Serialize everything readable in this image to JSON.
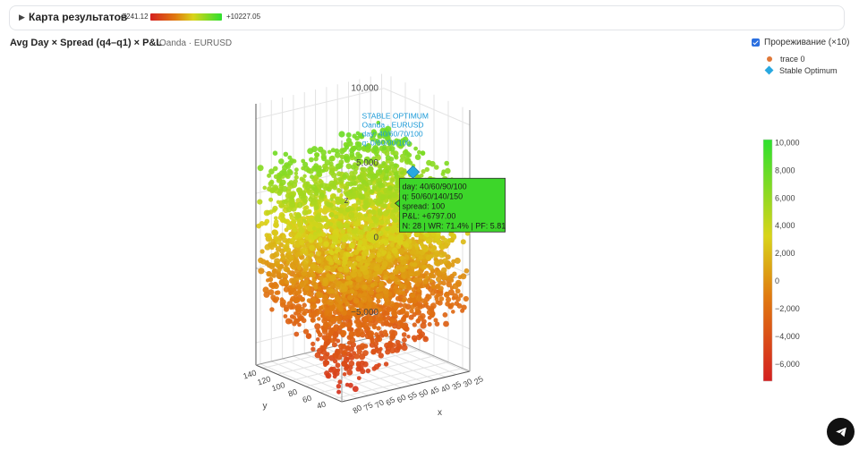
{
  "results_bar": {
    "title": "Карта результатов",
    "min_value": "-7241.12",
    "max_value": "+10227.05",
    "gradient_colors": [
      "#d42020",
      "#e07a10",
      "#d9d41a",
      "#2ee02e"
    ]
  },
  "heading": {
    "title": "Avg Day × Spread (q4–q1) × P&L",
    "subtitle": "Oanda · EURUSD"
  },
  "thinning": {
    "label": "Прореживание (×10)",
    "checked": true
  },
  "legend": {
    "items": [
      {
        "label": "trace 0",
        "color": "#e07838",
        "marker": "circle"
      },
      {
        "label": "Stable Optimum",
        "color": "#29a8e0",
        "marker": "diamond"
      }
    ]
  },
  "chart_data": {
    "type": "scatter3d",
    "axes": {
      "x": {
        "label": "x",
        "ticks": [
          25,
          30,
          35,
          40,
          45,
          50,
          55,
          60,
          65,
          70,
          75,
          80
        ]
      },
      "y": {
        "label": "y",
        "ticks": [
          40,
          60,
          80,
          100,
          120,
          140
        ]
      },
      "z": {
        "label": "z",
        "ticks": [
          -5000,
          0,
          5000,
          10000
        ],
        "tick_labels": [
          "−5,000",
          "0",
          "5,000",
          "10,000"
        ]
      }
    },
    "colorbar": {
      "min": -7241.12,
      "max": 10227.05,
      "ticks": [
        10000,
        8000,
        6000,
        4000,
        2000,
        0,
        -2000,
        -4000,
        -6000
      ],
      "tick_labels": [
        "10,000",
        "8,000",
        "6,000",
        "4,000",
        "2,000",
        "0",
        "−2,000",
        "−4,000",
        "−6,000"
      ]
    },
    "stable_optimum": {
      "x": 40,
      "y": 60,
      "z": 6797.0,
      "label_lines": [
        "STABLE OPTIMUM",
        "Oanda · EURUSD",
        "day: 40/60/70/100",
        "q: 0/60/90/100"
      ]
    },
    "tooltip": {
      "lines": [
        "day: 40/60/90/100",
        "q: 50/60/140/150",
        "spread: 100",
        "P&L: +6797.00",
        "N: 28 | WR: 71.4% | PF: 5.81"
      ]
    }
  }
}
